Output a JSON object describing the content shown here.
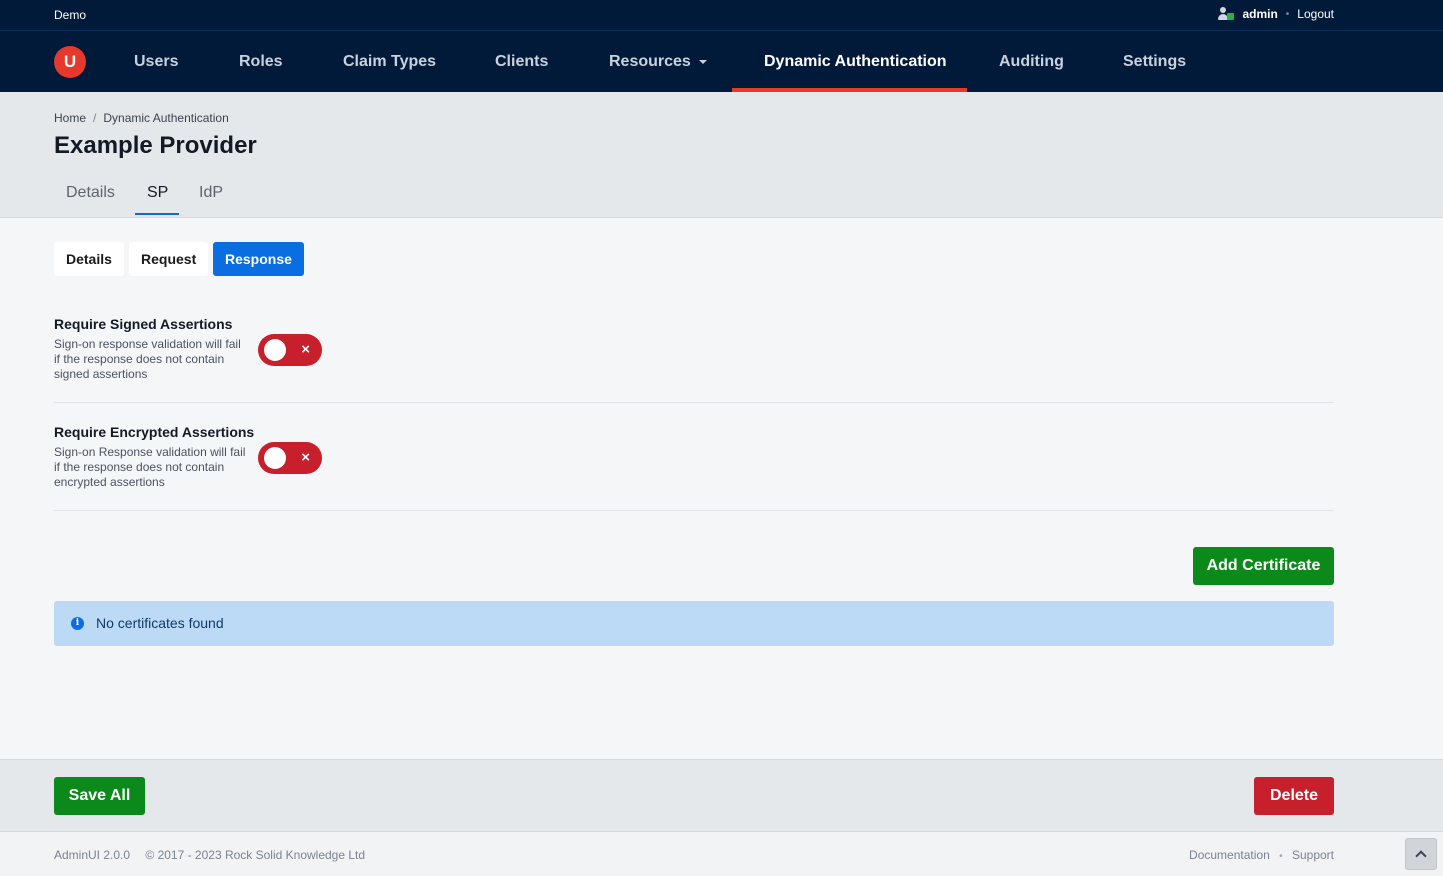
{
  "topbar": {
    "env": "Demo",
    "user": "admin",
    "sep": "•",
    "logout": "Logout"
  },
  "brand": {
    "logo_letter": "U",
    "accent": "#e5392d",
    "nav_bg": "#021a3a"
  },
  "nav": {
    "users": "Users",
    "roles": "Roles",
    "claim_types": "Claim Types",
    "clients": "Clients",
    "resources": "Resources",
    "dynamic_auth": "Dynamic Authentication",
    "auditing": "Auditing",
    "settings": "Settings",
    "active": "Dynamic Authentication"
  },
  "breadcrumb": {
    "home": "Home",
    "sep": "/",
    "current": "Dynamic Authentication"
  },
  "page": {
    "title": "Example Provider"
  },
  "tabs": {
    "details": "Details",
    "sp": "SP",
    "idp": "IdP",
    "active": "SP"
  },
  "subtabs": {
    "details": "Details",
    "request": "Request",
    "response": "Response",
    "active": "Response"
  },
  "settings": [
    {
      "label": "Require Signed Assertions",
      "desc": "Sign-on response validation will fail if the response does not contain signed assertions",
      "enabled": false,
      "toggle_glyph": "×"
    },
    {
      "label": "Require Encrypted Assertions",
      "desc": "Sign-on Response validation will fail if the response does not contain encrypted assertions",
      "enabled": false,
      "toggle_glyph": "×"
    }
  ],
  "certificates": {
    "add_label": "Add Certificate",
    "info_glyph": "i",
    "empty_message": "No certificates found"
  },
  "actions": {
    "save_all": "Save All",
    "delete": "Delete"
  },
  "footer": {
    "version": "AdminUI 2.0.0",
    "copyright": "© 2017 - 2023 Rock Solid Knowledge Ltd",
    "documentation": "Documentation",
    "sep": "•",
    "support": "Support"
  }
}
